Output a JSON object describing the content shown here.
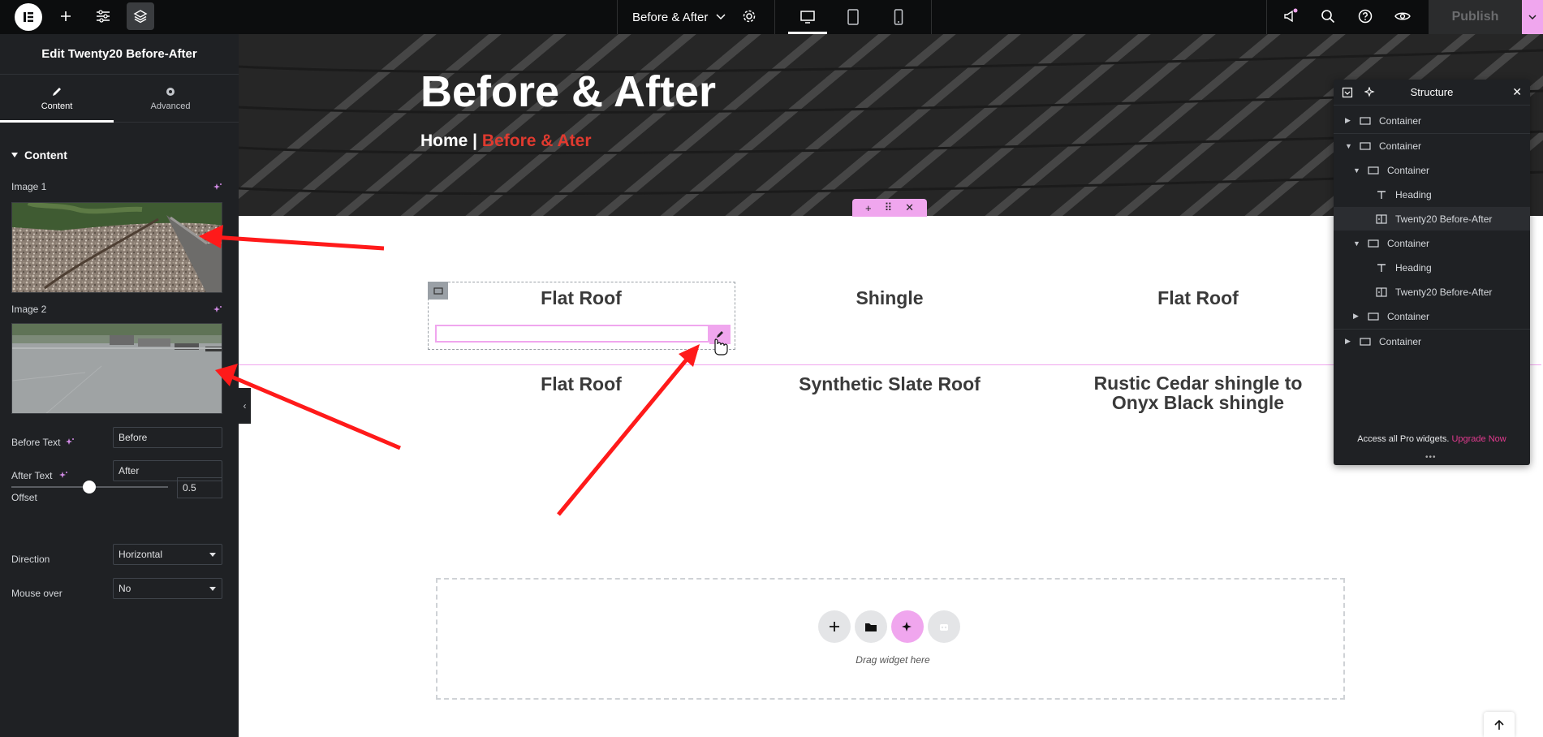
{
  "topbar": {
    "page_name": "Before & After",
    "publish_label": "Publish"
  },
  "panel": {
    "title": "Edit Twenty20 Before-After",
    "tabs": [
      {
        "label": "Content",
        "icon": "pencil-icon"
      },
      {
        "label": "Advanced",
        "icon": "gear-icon"
      }
    ],
    "section_title": "Content",
    "image1_label": "Image 1",
    "image2_label": "Image 2",
    "before_text_label": "Before Text",
    "before_text_value": "Before",
    "after_text_label": "After Text",
    "after_text_value": "After",
    "offset_label": "Offset",
    "offset_value": "0.5",
    "direction_label": "Direction",
    "direction_value": "Horizontal",
    "mouse_over_label": "Mouse over",
    "mouse_over_value": "No"
  },
  "hero": {
    "title": "Before & After",
    "crumb_home": "Home |",
    "crumb_current": "Before & Ater"
  },
  "grid": {
    "row1": [
      "Flat Roof",
      "Shingle",
      "Flat Roof"
    ],
    "row2": [
      "Flat Roof",
      "Synthetic Slate Roof",
      "Rustic Cedar shingle to Onyx Black shingle"
    ]
  },
  "dropzone": {
    "text": "Drag widget here"
  },
  "structure": {
    "title": "Structure",
    "rows": [
      {
        "label": "Container",
        "arrow": "▶",
        "type": "container"
      },
      {
        "label": "Container",
        "arrow": "▼",
        "type": "container"
      },
      {
        "label": "Container",
        "arrow": "▼",
        "type": "container"
      },
      {
        "label": "Heading",
        "arrow": "",
        "type": "heading"
      },
      {
        "label": "Twenty20 Before-After",
        "arrow": "",
        "type": "widget"
      },
      {
        "label": "Container",
        "arrow": "▼",
        "type": "container"
      },
      {
        "label": "Heading",
        "arrow": "",
        "type": "heading"
      },
      {
        "label": "Twenty20 Before-After",
        "arrow": "",
        "type": "widget"
      },
      {
        "label": "Container",
        "arrow": "▶",
        "type": "container"
      },
      {
        "label": "Container",
        "arrow": "▶",
        "type": "container"
      }
    ],
    "footer_text": "Access all Pro widgets.",
    "footer_link": "Upgrade Now"
  },
  "colors": {
    "accent_pink": "#f0a6ee",
    "panel_bg": "#1f2124",
    "arrow_red": "#ff1a1a",
    "breadcrumb_red": "#e03a2f"
  }
}
